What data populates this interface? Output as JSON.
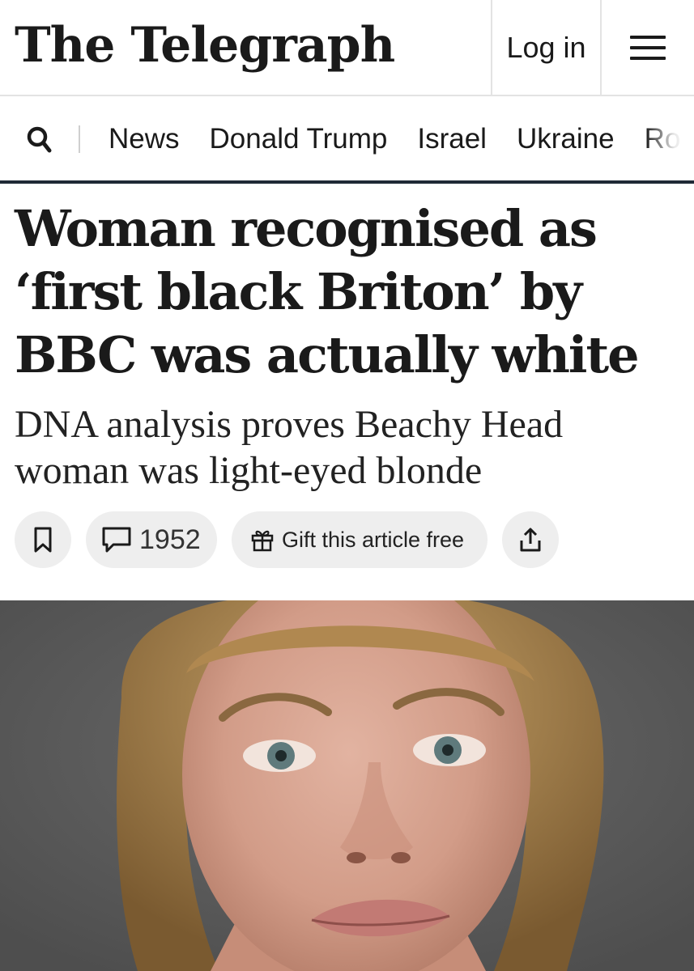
{
  "header": {
    "logo": "The Telegraph",
    "login_label": "Log in",
    "menu_icon": "hamburger-menu-icon"
  },
  "nav": {
    "search_icon": "search-icon",
    "items": [
      "News",
      "Donald Trump",
      "Israel",
      "Ukraine",
      "Ro"
    ]
  },
  "article": {
    "headline": "Woman recognised as ‘first black Briton’ by BBC was actually white",
    "standfirst": "DNA analysis proves Beachy Head woman was light-eyed blonde",
    "actions": {
      "bookmark_icon": "bookmark-icon",
      "comment_icon": "comment-icon",
      "comment_count": "1952",
      "gift_icon": "gift-icon",
      "gift_label": "Gift this article free",
      "share_icon": "share-icon"
    },
    "image": {
      "subject": "facial reconstruction portrait",
      "background_color": "#5c5c5c"
    }
  }
}
